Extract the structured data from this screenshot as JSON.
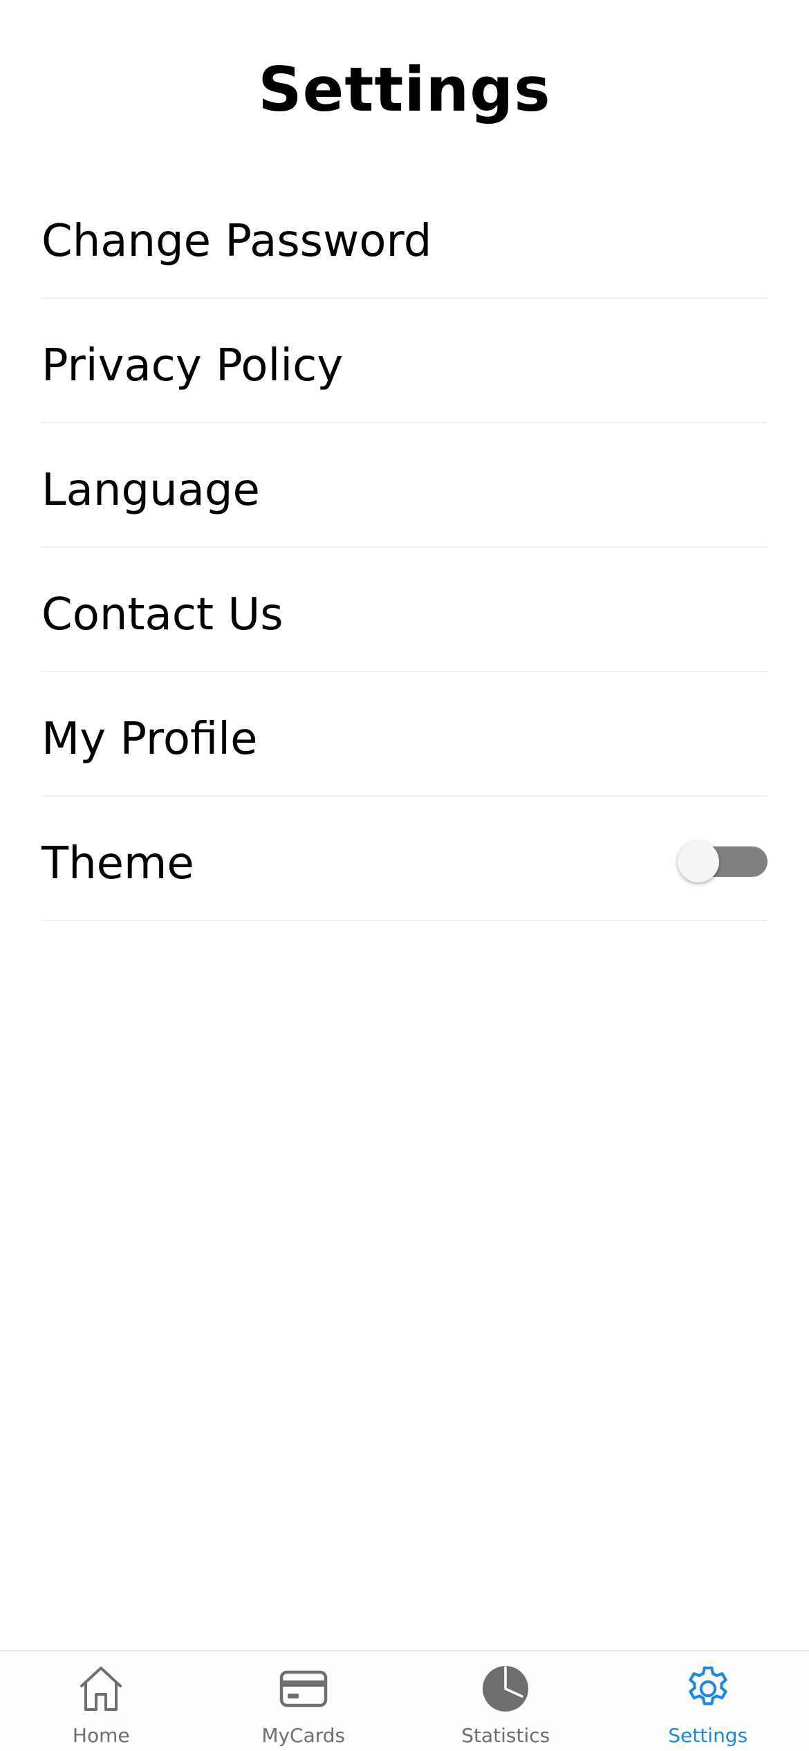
{
  "page": {
    "title": "Settings"
  },
  "settings": {
    "items": [
      {
        "label": "Change Password"
      },
      {
        "label": "Privacy Policy"
      },
      {
        "label": "Language"
      },
      {
        "label": "Contact Us"
      },
      {
        "label": "My Profile"
      },
      {
        "label": "Theme",
        "toggle": {
          "on": false
        }
      }
    ]
  },
  "tab_bar": {
    "active_color": "#1a88e6",
    "inactive_color": "#6e6e6e",
    "tabs": [
      {
        "label": "Home",
        "icon": "home-icon",
        "active": false
      },
      {
        "label": "MyCards",
        "icon": "card-icon",
        "active": false
      },
      {
        "label": "Statistics",
        "icon": "pie-chart-icon",
        "active": false
      },
      {
        "label": "Settings",
        "icon": "gear-icon",
        "active": true
      }
    ]
  }
}
